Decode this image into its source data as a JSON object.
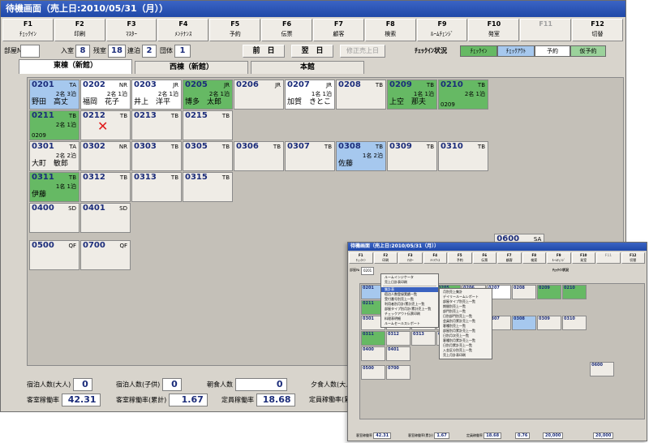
{
  "main_window": {
    "title": "待機画面（売上日:2010/05/31（月））",
    "fkeys": [
      {
        "key": "F1",
        "label": "ﾁｪｯｸｲﾝ",
        "enabled": true
      },
      {
        "key": "F2",
        "label": "印刷",
        "enabled": true
      },
      {
        "key": "F3",
        "label": "ﾏｽﾀｰ",
        "enabled": true
      },
      {
        "key": "F4",
        "label": "ﾒﾝﾃﾅﾝｽ",
        "enabled": true
      },
      {
        "key": "F5",
        "label": "予約",
        "enabled": true
      },
      {
        "key": "F6",
        "label": "伝票",
        "enabled": true
      },
      {
        "key": "F7",
        "label": "顧客",
        "enabled": true
      },
      {
        "key": "F8",
        "label": "検索",
        "enabled": true
      },
      {
        "key": "F9",
        "label": "ﾙｰﾑﾁｪﾝｼﾞ",
        "enabled": true
      },
      {
        "key": "F10",
        "label": "発室",
        "enabled": true
      },
      {
        "key": "F11",
        "label": "",
        "enabled": false
      },
      {
        "key": "F12",
        "label": "切替",
        "enabled": true
      }
    ],
    "status": {
      "room_no_label": "部屋№",
      "room_no_value": "",
      "occupied_label": "入室",
      "occupied_value": "8",
      "vacant_label": "残室",
      "vacant_value": "18",
      "consecutive_label": "連泊",
      "consecutive_value": "2",
      "group_label": "団体",
      "group_value": "1",
      "prev_day_btn": "前　日",
      "next_day_btn": "翌　日",
      "fix_sales_btn": "修正売上日",
      "checkin_status_label": "ﾁｪｯｸｲﾝ状況",
      "legend": [
        {
          "label": "ﾁｪｯｸｲﾝ",
          "color": "#66b964"
        },
        {
          "label": "ﾁｪｯｸｱｳﾄ",
          "color": "#a6c8ee"
        },
        {
          "label": "予約",
          "color": "#ffffff"
        },
        {
          "label": "仮予約",
          "color": "#9bd29b"
        }
      ]
    },
    "tabs": [
      {
        "label": "東棟（新館）",
        "active": true
      },
      {
        "label": "西棟（新館）",
        "active": false
      },
      {
        "label": "本館",
        "active": false
      }
    ],
    "rooms": [
      {
        "id": "0201",
        "type": "TA",
        "state": "reserved",
        "pax": "2名 3泊",
        "guest": "野田　高丈",
        "code": ""
      },
      {
        "id": "0202",
        "type": "NR",
        "state": "white",
        "pax": "2名 1泊",
        "guest": "福岡　花子",
        "code": ""
      },
      {
        "id": "0203",
        "type": "JR",
        "state": "white",
        "pax": "2名 1泊",
        "guest": "井上　洋平",
        "code": ""
      },
      {
        "id": "0205",
        "type": "JR",
        "state": "checkin",
        "pax": "2名 1泊",
        "guest": "博多　太郎",
        "code": ""
      },
      {
        "id": "0206",
        "type": "JR",
        "state": "normal",
        "pax": "",
        "guest": "",
        "code": ""
      },
      {
        "id": "0207",
        "type": "JR",
        "state": "white",
        "pax": "1名 1泊",
        "guest": "加賀　きとこ",
        "code": ""
      },
      {
        "id": "0208",
        "type": "TB",
        "state": "normal",
        "pax": "",
        "guest": "",
        "code": ""
      },
      {
        "id": "0209",
        "type": "TB",
        "state": "checkin",
        "pax": "1名 1泊",
        "guest": "上空　那夫",
        "code": ""
      },
      {
        "id": "0210",
        "type": "TB",
        "state": "checkin",
        "pax": "2名 1泊",
        "guest": "",
        "code": "0209"
      },
      {
        "id": "0211",
        "type": "TB",
        "state": "checkin",
        "pax": "2名 1泊",
        "guest": "",
        "code": "0209"
      },
      {
        "id": "0212",
        "type": "TB",
        "state": "normal",
        "pax": "",
        "guest": "",
        "code": "",
        "mark": "✕"
      },
      {
        "id": "0213",
        "type": "TB",
        "state": "normal",
        "pax": "",
        "guest": "",
        "code": ""
      },
      {
        "id": "0215",
        "type": "TB",
        "state": "normal",
        "pax": "",
        "guest": "",
        "code": ""
      },
      {
        "id": "0301",
        "type": "TA",
        "state": "normal",
        "pax": "2名 2泊",
        "guest": "大町　敏郎",
        "code": ""
      },
      {
        "id": "0302",
        "type": "NR",
        "state": "normal",
        "pax": "",
        "guest": "",
        "code": ""
      },
      {
        "id": "0303",
        "type": "TB",
        "state": "normal",
        "pax": "",
        "guest": "",
        "code": ""
      },
      {
        "id": "0305",
        "type": "TB",
        "state": "normal",
        "pax": "",
        "guest": "",
        "code": ""
      },
      {
        "id": "0306",
        "type": "TB",
        "state": "normal",
        "pax": "",
        "guest": "",
        "code": ""
      },
      {
        "id": "0307",
        "type": "TB",
        "state": "normal",
        "pax": "",
        "guest": "",
        "code": ""
      },
      {
        "id": "0308",
        "type": "TB",
        "state": "reserved",
        "pax": "1名 2泊",
        "guest": "佐藤",
        "code": ""
      },
      {
        "id": "0309",
        "type": "TB",
        "state": "normal",
        "pax": "",
        "guest": "",
        "code": ""
      },
      {
        "id": "0310",
        "type": "TB",
        "state": "normal",
        "pax": "",
        "guest": "",
        "code": ""
      },
      {
        "id": "0311",
        "type": "TB",
        "state": "checkin",
        "pax": "1名 1泊",
        "guest": "伊藤",
        "code": ""
      },
      {
        "id": "0312",
        "type": "TB",
        "state": "normal",
        "pax": "",
        "guest": "",
        "code": ""
      },
      {
        "id": "0313",
        "type": "TB",
        "state": "normal",
        "pax": "",
        "guest": "",
        "code": ""
      },
      {
        "id": "0315",
        "type": "TB",
        "state": "normal",
        "pax": "",
        "guest": "",
        "code": ""
      },
      {
        "id": "0400",
        "type": "SD",
        "state": "normal",
        "pax": "",
        "guest": "",
        "code": ""
      },
      {
        "id": "0401",
        "type": "SD",
        "state": "normal",
        "pax": "",
        "guest": "",
        "code": ""
      },
      {
        "id": "0500",
        "type": "QF",
        "state": "normal",
        "pax": "",
        "guest": "",
        "code": ""
      },
      {
        "id": "0700",
        "type": "QF",
        "state": "normal",
        "pax": "",
        "guest": "",
        "code": ""
      },
      {
        "id": "0600",
        "type": "SA",
        "state": "normal",
        "pax": "",
        "guest": "",
        "code": ""
      }
    ],
    "stats": {
      "guests_adult_label": "宿泊人数(大人)",
      "guests_adult_value": "0",
      "guests_child_label": "宿泊人数(子供)",
      "guests_child_value": "0",
      "breakfast_label": "朝食人数",
      "breakfast_value": "0",
      "dinner_label": "夕食人数(大人)",
      "dinner_value": "0",
      "occupancy_label": "客室稼働率",
      "occupancy_value": "42.31",
      "occupancy_cum_label": "客室稼働率(累計)",
      "occupancy_cum_value": "1.67",
      "fixed_rate_label": "定員稼働率",
      "fixed_rate_value": "18.68",
      "fixed_rate_cum_label": "定員稼働率(累"
    }
  },
  "overlay_window": {
    "title": "待機画面（売上日:2010/05/31（月））",
    "room_no_value": "0201",
    "menu_main": [
      "ルームインジケータ",
      "売上日計表印刷",
      "集計表",
      "宿泊人数登録実績一覧",
      "受付番号別売上一覧",
      "利用者別月計/累計売上一覧",
      "部屋タイプ別月計/累計売上一覧",
      "チェックアウト伝票印刷",
      "料理表明細",
      "ルームセールスレポート"
    ],
    "menu_sub": [
      "月別売上集計",
      "デイリールームレポート",
      "部屋タイプ別売上一覧",
      "期間別売上一覧",
      "部門別売上一覧",
      "日別部門別売上一覧",
      "会員別月累計売上一覧",
      "客種別売上一覧",
      "部屋別月累計売上一覧",
      "日別月次売上一覧",
      "客種別月累計売上一覧",
      "日別月累計売上一覧",
      "入金区分別売上一覧",
      "売上月計表印刷"
    ],
    "stats": {
      "occupancy_value": "42.31",
      "occupancy_cum_value": "1.67",
      "fixed_rate_value": "18.68",
      "fixed_rate_cum_value": "0.76",
      "sales_value": "20,000",
      "sales_cum_value": "20,000"
    }
  }
}
